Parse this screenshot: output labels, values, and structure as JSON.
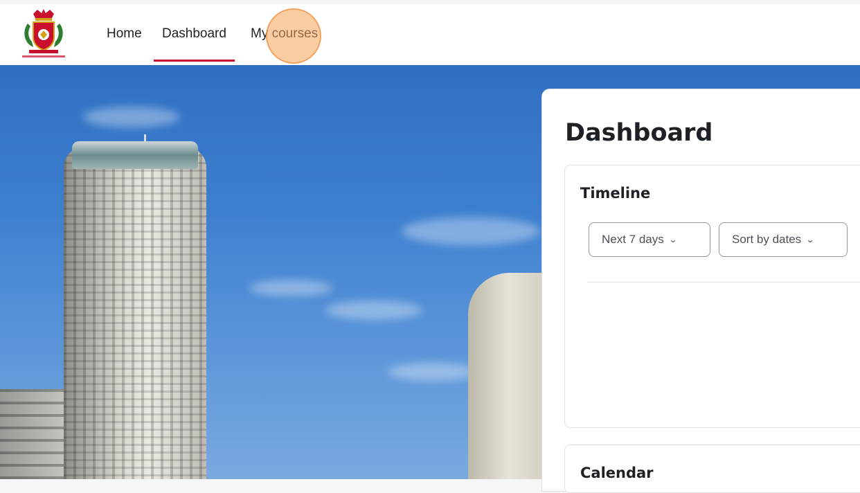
{
  "nav": {
    "logo_icon": "school-crest-logo",
    "items": [
      {
        "label": "Home",
        "active": false
      },
      {
        "label": "Dashboard",
        "active": true
      },
      {
        "label": "My courses",
        "active": false
      }
    ]
  },
  "page": {
    "title": "Dashboard"
  },
  "timeline": {
    "title": "Timeline",
    "filter_selected": "Next 7 days",
    "sort_selected": "Sort by dates",
    "chevron_icon": "chevron-down-icon"
  },
  "calendar": {
    "title": "Calendar"
  },
  "colors": {
    "accent": "#c8102e",
    "click_highlight": "#f6a458"
  }
}
